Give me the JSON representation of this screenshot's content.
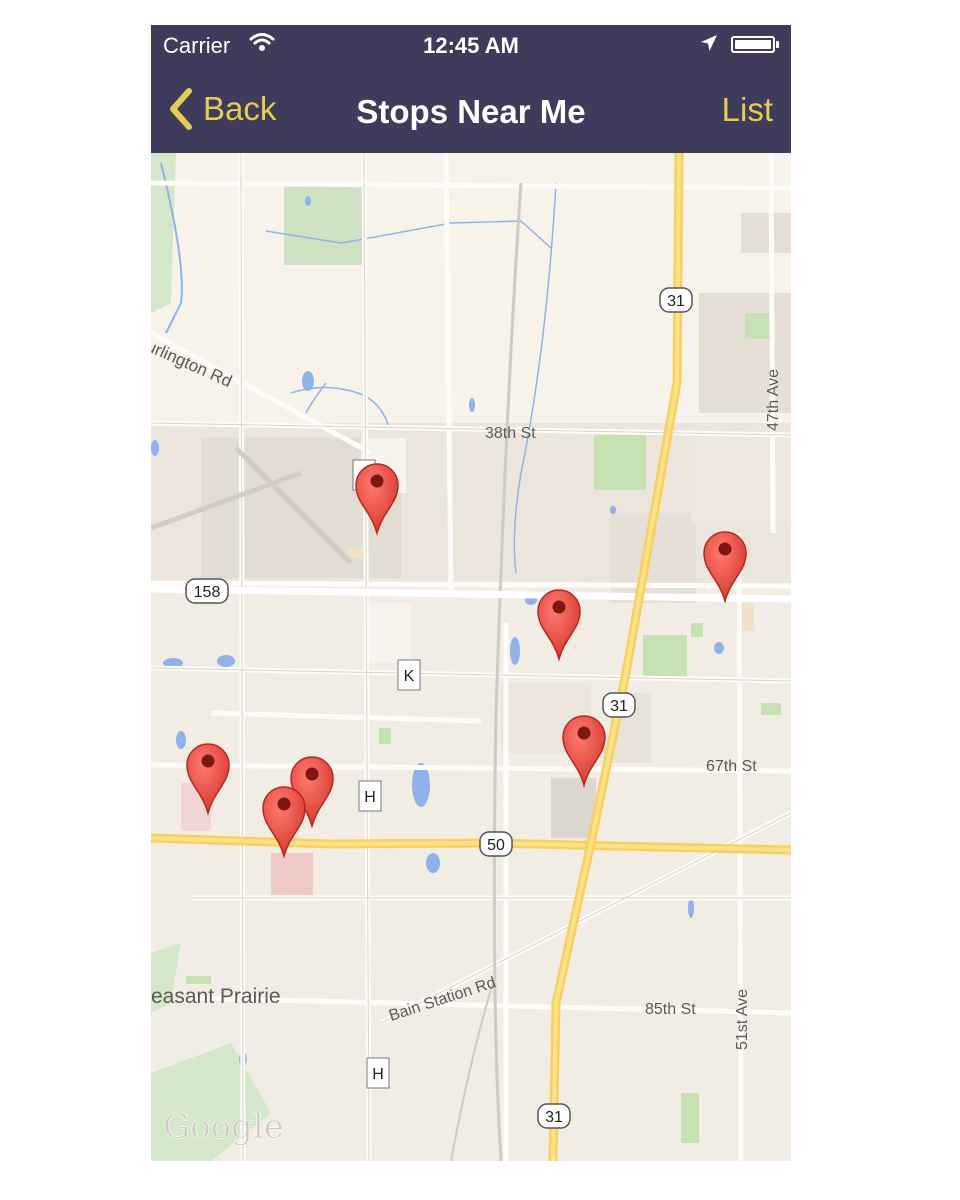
{
  "status_bar": {
    "carrier": "Carrier",
    "time": "12:45 AM"
  },
  "nav": {
    "back_label": "Back",
    "title": "Stops Near Me",
    "list_label": "List"
  },
  "map": {
    "road_labels": {
      "burlington": "urlington Rd",
      "38th": "38th St",
      "47th": "47th Ave",
      "67th": "67th St",
      "85th": "85th St",
      "51st": "51st Ave",
      "bain": "Bain Station Rd"
    },
    "place_label": "easant Prairie",
    "route_shields": {
      "r31_top": "31",
      "r158": "158",
      "r31_mid": "31",
      "r50": "50",
      "r31_bottom": "31"
    },
    "markers": {
      "k": "K",
      "h1": "H",
      "h2": "H"
    },
    "attribution": "Google",
    "stop_pins": [
      "stop-1",
      "stop-2",
      "stop-3",
      "stop-4",
      "stop-5",
      "stop-6",
      "stop-7"
    ]
  },
  "colors": {
    "bar": "#3f3b5b",
    "accent": "#e4cd50",
    "pin": "#e8483f"
  }
}
